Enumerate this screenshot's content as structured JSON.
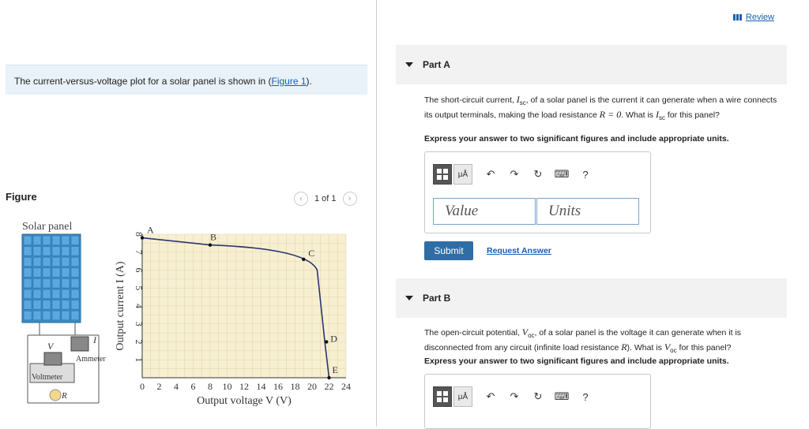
{
  "left": {
    "intro_text": "The current-versus-voltage plot for a solar panel is shown in (",
    "intro_link": "Figure 1",
    "intro_end": ").",
    "figure_label": "Figure",
    "pager_text": "1 of 1",
    "figure": {
      "panel_title": "Solar panel",
      "label_V": "V",
      "label_I": "I",
      "ammeter": "Ammeter",
      "voltmeter": "Voltmeter",
      "label_R": "R"
    }
  },
  "chart_data": {
    "type": "line",
    "xlabel": "Output voltage V (V)",
    "ylabel": "Output current I (A)",
    "xlim": [
      0,
      24
    ],
    "ylim": [
      0,
      8
    ],
    "x_ticks": [
      "0",
      "2",
      "4",
      "6",
      "8",
      "10",
      "12",
      "14",
      "16",
      "18",
      "20",
      "22",
      "24"
    ],
    "y_ticks": [
      "1",
      "2",
      "3",
      "4",
      "5",
      "6",
      "7",
      "8"
    ],
    "series": [
      {
        "x": [
          0,
          8,
          18,
          20.8,
          21.5,
          22
        ],
        "y": [
          7.8,
          7.4,
          6.8,
          5.5,
          2.0,
          0
        ]
      }
    ],
    "point_labels": [
      {
        "label": "A",
        "x": 0,
        "y": 7.8
      },
      {
        "label": "B",
        "x": 8,
        "y": 7.4
      },
      {
        "label": "C",
        "x": 19,
        "y": 6.6
      },
      {
        "label": "D",
        "x": 21.7,
        "y": 2.0
      },
      {
        "label": "E",
        "x": 22,
        "y": 0
      }
    ],
    "grid": true
  },
  "right": {
    "review": "Review",
    "partA": {
      "title": "Part A",
      "q1": "The short-circuit current, ",
      "q2": ", of a solar panel is the current it can generate when a wire connects its output terminals, making the load resistance ",
      "q3": ". What is ",
      "q4": " for this panel?",
      "sym_I": "I",
      "sym_sub": "sc",
      "eq": "R = 0",
      "instruction": "Express your answer to two significant figures and include appropriate units.",
      "value_placeholder": "Value",
      "units_placeholder": "Units",
      "submit": "Submit",
      "request": "Request Answer"
    },
    "partB": {
      "title": "Part B",
      "q1": "The open-circuit potential, ",
      "q2": ", of a solar panel is the voltage it can generate when it is disconnected from any circuit (infinite load resistance ",
      "q3": "). What is ",
      "q4": " for this panel?",
      "sym_V": "V",
      "sym_sub": "oc",
      "sym_R": "R",
      "instruction": "Express your answer to two significant figures and include appropriate units."
    },
    "toolbar": {
      "mu_label": "μÅ",
      "help": "?"
    }
  }
}
